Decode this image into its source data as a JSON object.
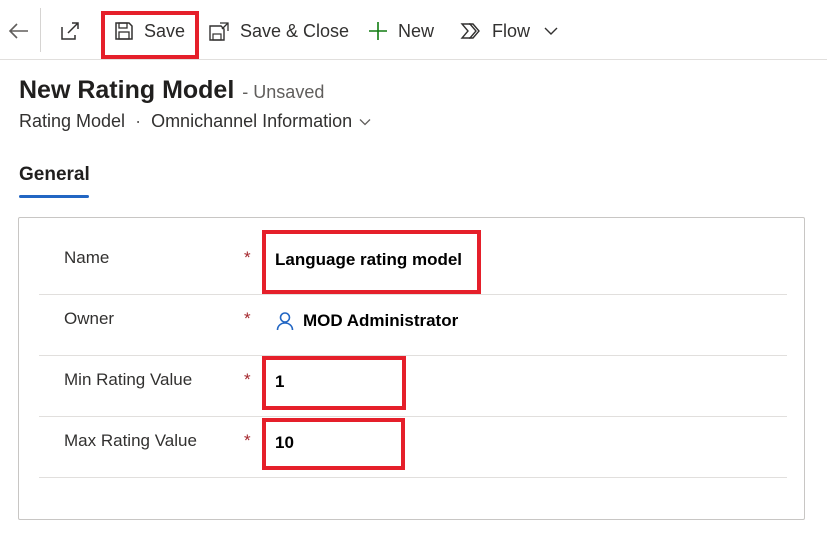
{
  "toolbar": {
    "back_icon": "back-arrow-icon",
    "popout_icon": "open-in-new-window-icon",
    "save_label": "Save",
    "save_close_label": "Save & Close",
    "new_label": "New",
    "flow_label": "Flow",
    "more_icon": "chevron-down-icon"
  },
  "header": {
    "title": "New Rating Model",
    "status": "- Unsaved",
    "entity": "Rating Model",
    "separator": "·",
    "form_selector": "Omnichannel Information"
  },
  "tabs": [
    {
      "label": "General",
      "active": true
    }
  ],
  "form": {
    "fields": [
      {
        "label": "Name",
        "required": "*",
        "value": "Language rating model"
      },
      {
        "label": "Owner",
        "required": "*",
        "value": "MOD Administrator",
        "type": "lookup"
      },
      {
        "label": "Min Rating Value",
        "required": "*",
        "value": "1"
      },
      {
        "label": "Max Rating Value",
        "required": "*",
        "value": "10"
      }
    ]
  },
  "colors": {
    "highlight": "#e51f2a",
    "accent": "#2266c3",
    "required": "#a4262c"
  }
}
